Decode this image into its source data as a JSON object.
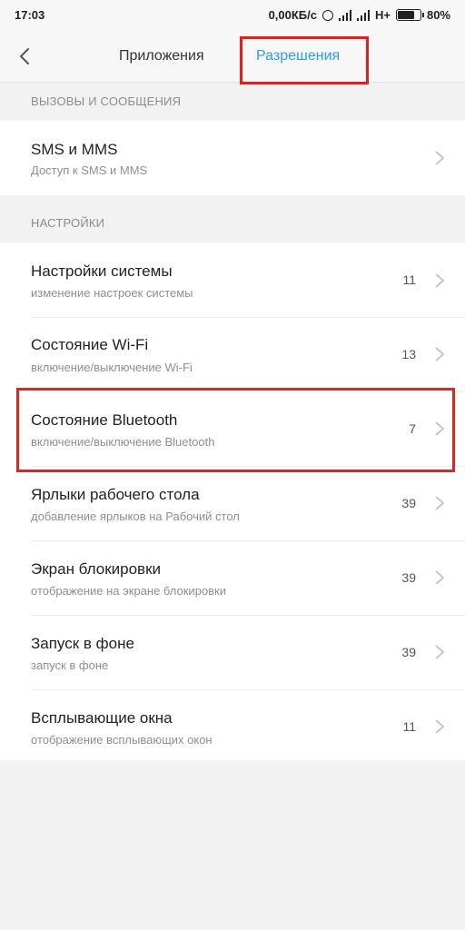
{
  "status": {
    "time": "17:03",
    "speed": "0,00КБ/с",
    "network": "H+",
    "battery": "80%",
    "battery_level": 0.8
  },
  "header": {
    "tab_apps": "Приложения",
    "tab_permissions": "Разрешения"
  },
  "sections": [
    {
      "title": "ВЫЗОВЫ И СООБЩЕНИЯ",
      "items": [
        {
          "title": "SMS и MMS",
          "subtitle": "Доступ к SMS и MMS",
          "count": ""
        }
      ]
    },
    {
      "title": "НАСТРОЙКИ",
      "items": [
        {
          "title": "Настройки системы",
          "subtitle": "изменение настроек системы",
          "count": "11"
        },
        {
          "title": "Состояние Wi-Fi",
          "subtitle": "включение/выключение Wi-Fi",
          "count": "13"
        },
        {
          "title": "Состояние Bluetooth",
          "subtitle": "включение/выключение Bluetooth",
          "count": "7"
        },
        {
          "title": "Ярлыки рабочего стола",
          "subtitle": "добавление ярлыков на Рабочий стол",
          "count": "39"
        },
        {
          "title": "Экран блокировки",
          "subtitle": "отображение на экране блокировки",
          "count": "39"
        },
        {
          "title": "Запуск в фоне",
          "subtitle": "запуск в фоне",
          "count": "39"
        },
        {
          "title": "Всплывающие окна",
          "subtitle": "отображение всплывающих окон",
          "count": "11"
        }
      ]
    }
  ],
  "colors": {
    "accent": "#2a9df4",
    "highlight": "#e02020"
  },
  "icons": [
    "alarm-icon",
    "signal-icon",
    "battery-icon",
    "back-arrow-icon",
    "chevron-right-icon"
  ]
}
